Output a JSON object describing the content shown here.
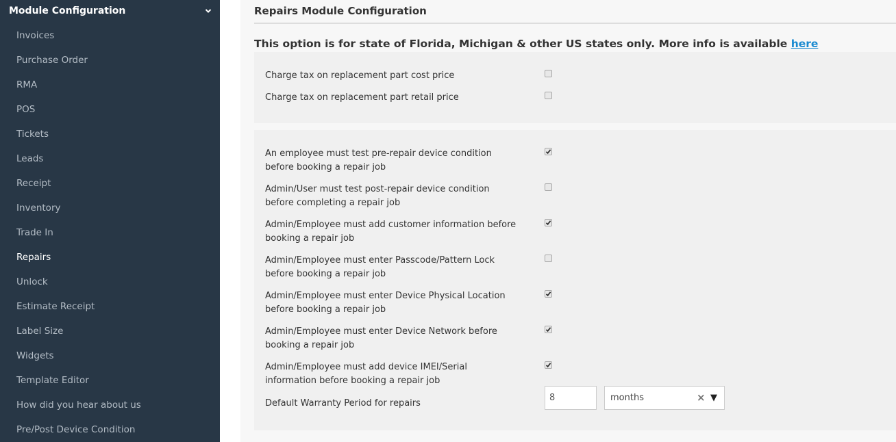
{
  "sidebar": {
    "header": "Module Configuration",
    "header_icon": "chevron-down-icon",
    "items": [
      {
        "label": "Invoices",
        "active": false
      },
      {
        "label": "Purchase Order",
        "active": false
      },
      {
        "label": "RMA",
        "active": false
      },
      {
        "label": "POS",
        "active": false
      },
      {
        "label": "Tickets",
        "active": false
      },
      {
        "label": "Leads",
        "active": false
      },
      {
        "label": "Receipt",
        "active": false
      },
      {
        "label": "Inventory",
        "active": false
      },
      {
        "label": "Trade In",
        "active": false
      },
      {
        "label": "Repairs",
        "active": true
      },
      {
        "label": "Unlock",
        "active": false
      },
      {
        "label": "Estimate Receipt",
        "active": false
      },
      {
        "label": "Label Size",
        "active": false
      },
      {
        "label": "Widgets",
        "active": false
      },
      {
        "label": "Template Editor",
        "active": false
      },
      {
        "label": "How did you hear about us",
        "active": false
      },
      {
        "label": "Pre/Post Device Condition",
        "active": false
      }
    ]
  },
  "main": {
    "title": "Repairs Module Configuration",
    "notice_text": "This option is for state of Florida, Michigan & other US states only. More info is available ",
    "notice_link": "here",
    "tax_options": [
      {
        "label": "Charge tax on replacement part cost price",
        "checked": false
      },
      {
        "label": "Charge tax on replacement part retail price",
        "checked": false
      }
    ],
    "requirements": [
      {
        "label": "An employee must test pre-repair device condition before booking a repair job",
        "checked": true
      },
      {
        "label": "Admin/User must test post-repair device condition before completing a repair job",
        "checked": false
      },
      {
        "label": "Admin/Employee must add customer information before booking a repair job",
        "checked": true
      },
      {
        "label": "Admin/Employee must enter Passcode/Pattern Lock before booking a repair job",
        "checked": false
      },
      {
        "label": "Admin/Employee must enter Device Physical Location before booking a repair job",
        "checked": true
      },
      {
        "label": "Admin/Employee must enter Device Network before booking a repair job",
        "checked": true
      },
      {
        "label": "Admin/Employee must add device IMEI/Serial information before booking a repair job",
        "checked": true
      }
    ],
    "warranty": {
      "label": "Default Warranty Period for repairs",
      "value": "8",
      "unit": "months",
      "clear_glyph": "×",
      "arrow_glyph": "▼"
    }
  },
  "colors": {
    "sidebar_bg": "#283746",
    "link": "#1a8ad0",
    "panel_bg": "#f0f0f0"
  }
}
